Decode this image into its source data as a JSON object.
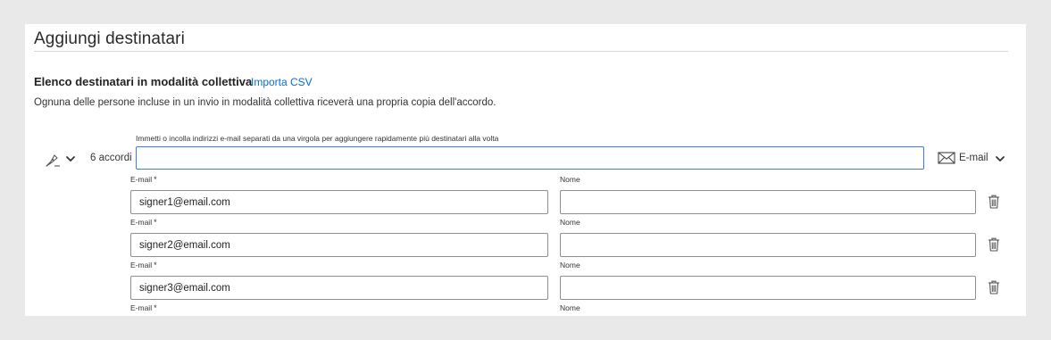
{
  "page": {
    "title": "Aggiungi destinatari"
  },
  "bulk": {
    "section_title": "Elenco destinatari in modalità collettiva",
    "import_link": "Importa CSV",
    "description": "Ognuna delle persone incluse in un invio in modalità collettiva riceverà una propria copia dell'accordo.",
    "input_hint": "Immetti o incolla indirizzi e-mail separati da una virgola per aggiungere rapidamente più destinatari alla volta",
    "input_value": "",
    "count_label": "6 accordi",
    "signer_icon": "pen-nib-icon",
    "auth_label": "E-mail",
    "auth_icon": "envelope-icon"
  },
  "recipients": {
    "email_label": "E-mail",
    "required_mark": "*",
    "name_label": "Nome",
    "delete_icon": "trash-icon",
    "rows": [
      {
        "email": "signer1@email.com",
        "name": ""
      },
      {
        "email": "signer2@email.com",
        "name": ""
      },
      {
        "email": "signer3@email.com",
        "name": ""
      },
      {
        "email": "",
        "name": ""
      }
    ]
  },
  "colors": {
    "link": "#0b6ad1",
    "focus_border": "#3c7dd7",
    "field_border": "#8f8f8f",
    "background": "#e9e9e9"
  }
}
